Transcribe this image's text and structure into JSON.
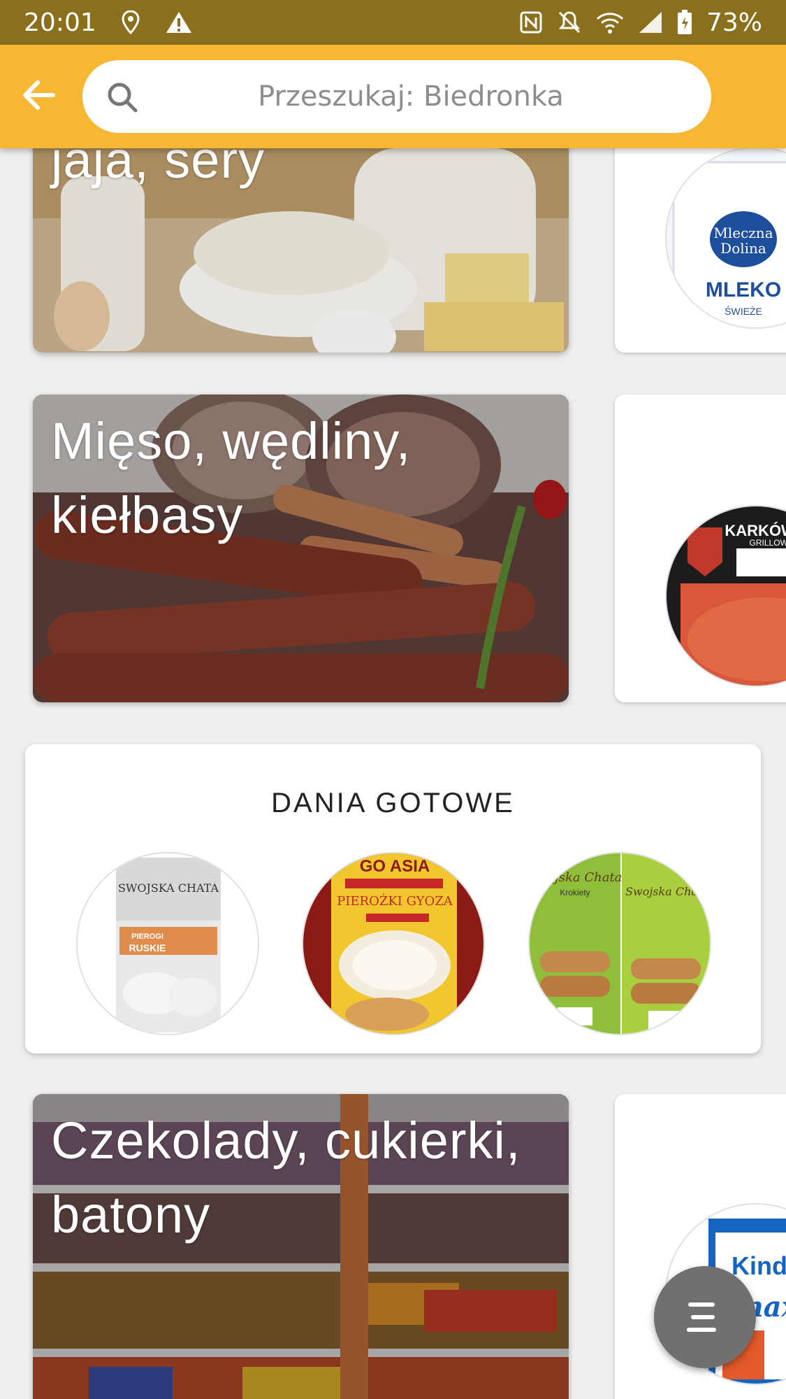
{
  "status_bar": {
    "time": "20:01",
    "battery": "73%",
    "icons": [
      "location-icon",
      "warning-icon",
      "nfc-icon",
      "mute-icon",
      "wifi-icon",
      "signal-icon",
      "battery-icon"
    ]
  },
  "app_bar": {
    "search_placeholder": "Przeszukaj: Biedronka",
    "background_color": "#f7b733"
  },
  "categories": [
    {
      "title": "jaja, sery",
      "side_label": "MLEKO",
      "side_sub": "ŚWIEŻE"
    },
    {
      "title": "Mięso, wędliny, kiełbasy",
      "side_label": "KARKÓWKA",
      "side_sub": "GRILLOWA"
    },
    {
      "title": "Czekolady, cukierki, batony",
      "side_label": "Kinder",
      "side_sub": "maxi"
    }
  ],
  "section": {
    "title": "DANIA GOTOWE",
    "products": [
      {
        "brand": "SWOJSKA CHATA",
        "name": "PIEROGI RUSKIE"
      },
      {
        "brand": "GO ASIA",
        "name": "PIEROŻKI GYOZA"
      },
      {
        "brand": "Swojska Chata",
        "name": "Krokiety"
      }
    ]
  },
  "fab": {
    "icon": "menu-icon"
  }
}
